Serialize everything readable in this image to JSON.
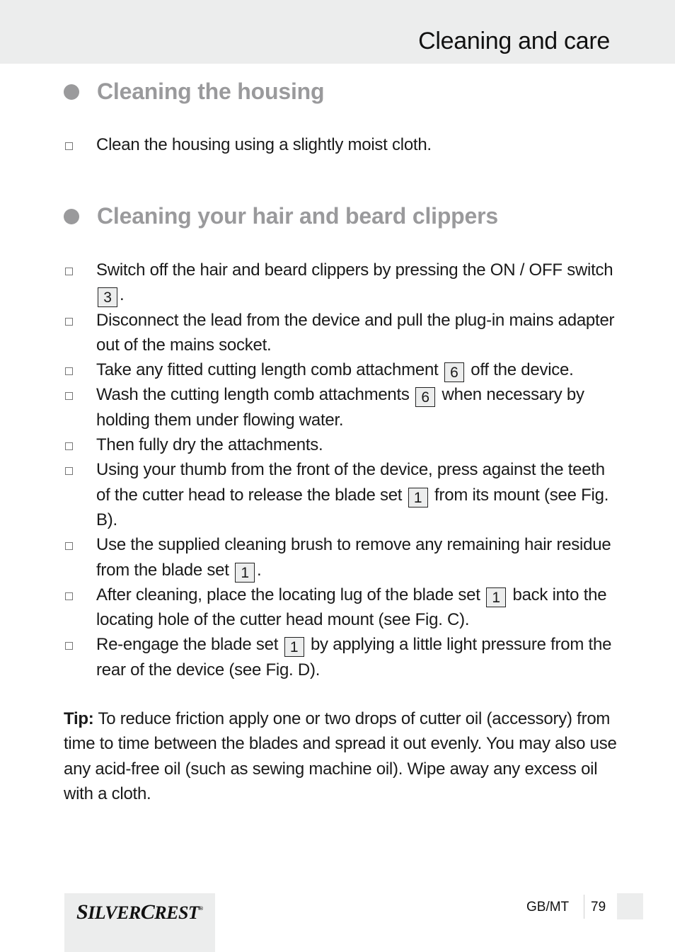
{
  "header": {
    "title": "Cleaning and care"
  },
  "sections": [
    {
      "heading": "Cleaning the housing",
      "items": [
        {
          "parts": [
            {
              "t": "Clean the housing using a slightly moist cloth."
            }
          ]
        }
      ]
    },
    {
      "heading": "Cleaning your hair and beard clippers",
      "items": [
        {
          "parts": [
            {
              "t": "Switch off the hair and beard clippers by pressing the ON / OFF switch "
            },
            {
              "ref": "3"
            },
            {
              "t": "."
            }
          ]
        },
        {
          "parts": [
            {
              "t": "Disconnect the lead from the device and pull the plug-in mains adapter out of the mains socket."
            }
          ]
        },
        {
          "parts": [
            {
              "t": "Take any fitted cutting length comb attachment "
            },
            {
              "ref": "6"
            },
            {
              "t": " off the device."
            }
          ]
        },
        {
          "parts": [
            {
              "t": "Wash the cutting length comb attachments "
            },
            {
              "ref": "6"
            },
            {
              "t": " when necessary by holding them under flowing water."
            }
          ]
        },
        {
          "parts": [
            {
              "t": "Then fully dry the attachments."
            }
          ]
        },
        {
          "parts": [
            {
              "t": "Using your thumb from the front of the device, press against the teeth of the cutter head to release the blade set "
            },
            {
              "ref": "1"
            },
            {
              "t": " from its mount (see Fig. B)."
            }
          ]
        },
        {
          "parts": [
            {
              "t": "Use the supplied cleaning brush to remove any remaining hair residue from the blade set "
            },
            {
              "ref": "1"
            },
            {
              "t": "."
            }
          ]
        },
        {
          "parts": [
            {
              "t": "After cleaning, place the locating lug of the blade set "
            },
            {
              "ref": "1"
            },
            {
              "t": " back into the locating hole of the cutter head mount (see Fig. C)."
            }
          ]
        },
        {
          "parts": [
            {
              "t": "Re-engage the blade set "
            },
            {
              "ref": "1"
            },
            {
              "t": " by applying a little light pressure from the rear of the device (see Fig. D)."
            }
          ]
        }
      ]
    }
  ],
  "tip": {
    "label": "Tip:",
    "text": " To reduce friction apply one or two drops of cutter oil (accessory) from time to time between the blades and spread it out evenly. You may also use any acid-free oil (such as sewing machine oil). Wipe away any excess oil with a cloth."
  },
  "footer": {
    "brand": {
      "s": "S",
      "ilver": "ILVER",
      "c": "C",
      "rest": "REST",
      "reg": "®"
    },
    "language": "GB/MT",
    "page_number": "79"
  },
  "icons": {
    "section_bullet": "filled-circle-icon",
    "list_bullet": "checkbox-square-icon"
  },
  "colors": {
    "heading_gray": "#9a9a9c",
    "band_gray": "#eceded",
    "text": "#1a1a1a"
  }
}
